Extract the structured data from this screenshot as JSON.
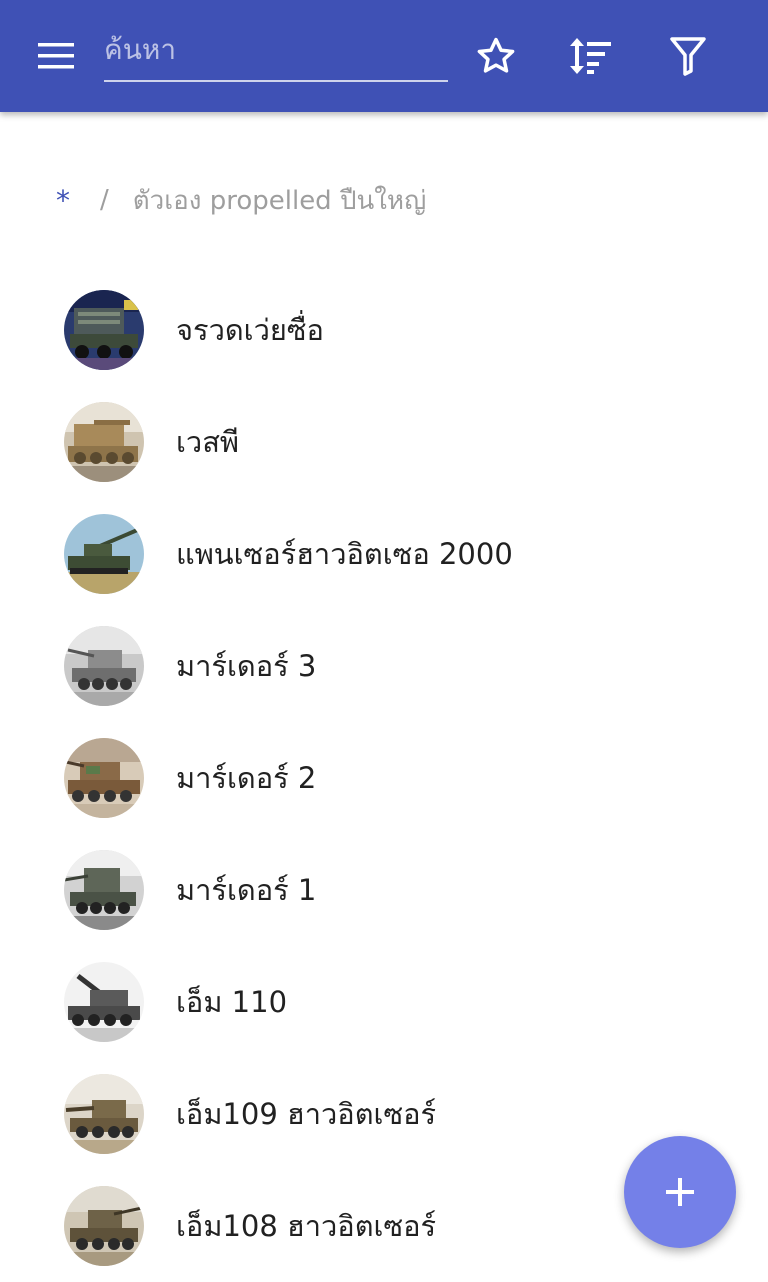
{
  "toolbar": {
    "search_placeholder": "ค้นหา",
    "search_value": ""
  },
  "breadcrumb": {
    "root": "*",
    "separator": "/",
    "current": "ตัวเอง propelled ปืนใหญ่"
  },
  "items": [
    {
      "label": "จรวดเว่ยซื่อ"
    },
    {
      "label": "เวสพี"
    },
    {
      "label": "แพนเซอร์ฮาวอิตเซอ 2000"
    },
    {
      "label": "มาร์เดอร์ 3"
    },
    {
      "label": "มาร์เดอร์ 2"
    },
    {
      "label": "มาร์เดอร์ 1"
    },
    {
      "label": "เอ็ม 110"
    },
    {
      "label": "เอ็ม109 ฮาวอิตเซอร์"
    },
    {
      "label": "เอ็ม108 ฮาวอิตเซอร์"
    }
  ],
  "colors": {
    "appbar": "#3f51b5",
    "fab": "#7480e8",
    "breadcrumb_root": "#3f51b5",
    "secondary_text": "#9e9e9e"
  },
  "icons": [
    "menu-icon",
    "star-icon",
    "sort-icon",
    "filter-icon",
    "plus-icon"
  ]
}
